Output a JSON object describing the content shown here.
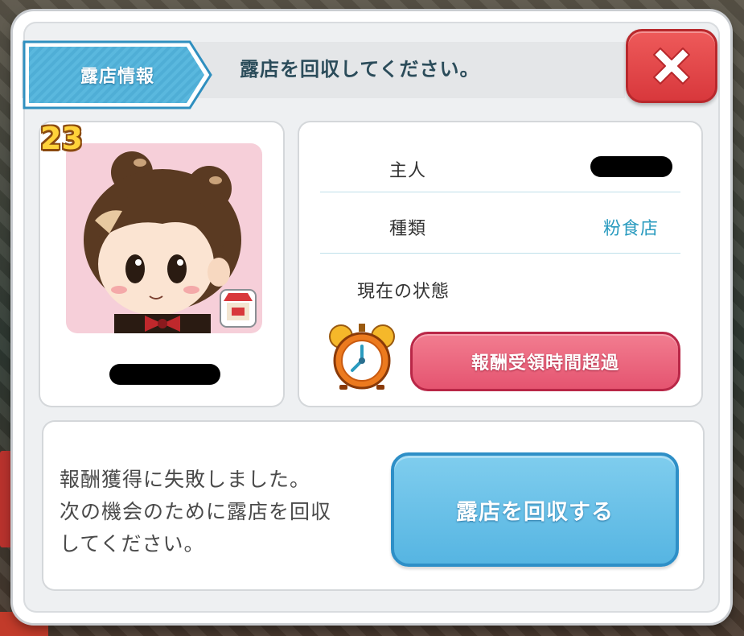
{
  "header": {
    "tab_label": "露店情報",
    "message": "露店を回収してください。"
  },
  "icons": {
    "close": "close-x-icon",
    "alarm": "alarm-clock-icon",
    "shop": "stall-icon"
  },
  "profile": {
    "level": "23",
    "name": "",
    "name_redacted": true
  },
  "info": {
    "owner_label": "主人",
    "owner_value_redacted": true,
    "type_label": "種類",
    "type_value": "粉食店",
    "status_label": "現在の状態",
    "status_badge": "報酬受領時間超過"
  },
  "footer": {
    "message_lines": [
      "報酬獲得に失敗しました。",
      "次の機会のために露店を回収",
      "してください。"
    ],
    "recall_button": "露店を回収する"
  },
  "colors": {
    "tab_blue": "#5bb6dc",
    "close_red": "#e34447",
    "status_pink": "#e55470",
    "button_blue": "#56b5e2",
    "value_teal": "#2a9bbf"
  }
}
